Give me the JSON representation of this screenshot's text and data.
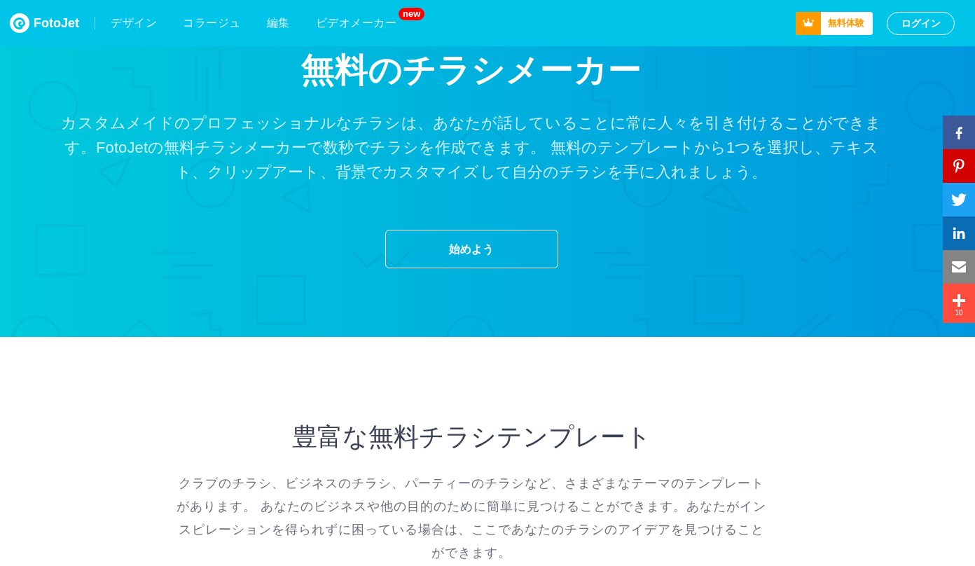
{
  "header": {
    "logo_text": "FotoJet",
    "nav": [
      {
        "label": "デザイン"
      },
      {
        "label": "コラージュ"
      },
      {
        "label": "編集"
      },
      {
        "label": "ビデオメーカー",
        "badge": "new"
      }
    ],
    "trial_button": "無料体験",
    "login_button": "ログイン"
  },
  "hero": {
    "title": "無料のチラシメーカー",
    "description": "カスタムメイドのプロフェッショナルなチラシは、あなたが話していることに常に人々を引き付けることができます。FotoJetの無料チラシメーカーで数秒でチラシを作成できます。 無料のテンプレートから1つを選択し、テキスト、クリップアート、背景でカスタマイズして自分のチラシを手に入れましょう。",
    "cta_button": "始めよう"
  },
  "share_bar": {
    "items": [
      {
        "kind": "facebook",
        "color": "#3b5998"
      },
      {
        "kind": "pinterest",
        "color": "#d50000"
      },
      {
        "kind": "twitter",
        "color": "#1da1f2"
      },
      {
        "kind": "linkedin",
        "color": "#0a6cb2"
      },
      {
        "kind": "email",
        "color": "#848484"
      },
      {
        "kind": "more",
        "color": "#fd4d3f",
        "count": "10"
      }
    ]
  },
  "templates_section": {
    "title": "豊富な無料チラシテンプレート",
    "description": "クラブのチラシ、ビジネスのチラシ、パーティーのチラシなど、さまざまなテーマのテンプレートがあります。 あなたのビジネスや他の目的のために簡単に見つけることができます。あなたがインスピレーションを得られずに困っている場合は、ここであなたのチラシのアイデアを見つけることができます。"
  }
}
